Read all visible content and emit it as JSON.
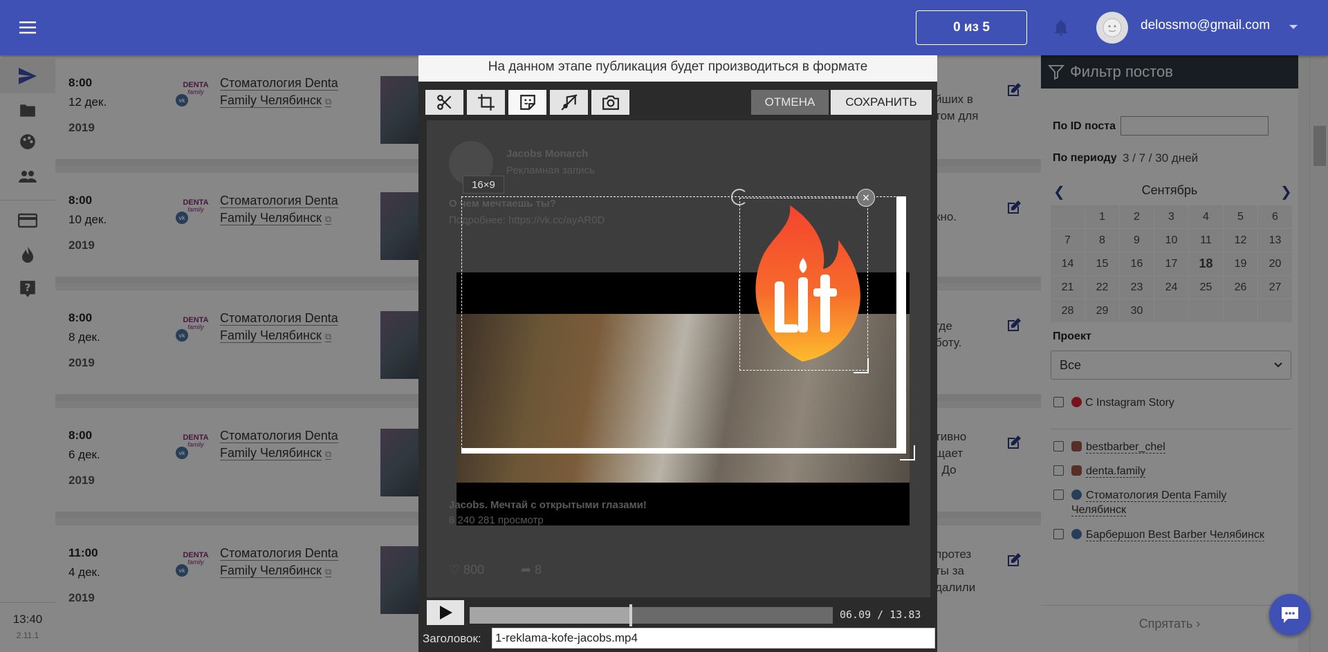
{
  "header": {
    "counter": "0 из 5",
    "user_email": "delossmo@gmail.com"
  },
  "nav": {
    "time": "13:40",
    "version": "2.11.1"
  },
  "posts": [
    {
      "time": "8:00",
      "date": "12 дек.",
      "year": "2019",
      "page": "Стоматология Denta Family Челябинск",
      "text_lines": [
        "йших в",
        "том для"
      ]
    },
    {
      "time": "8:00",
      "date": "10 дек.",
      "year": "2019",
      "page": "Стоматология Denta Family Челябинск",
      "text_lines": [
        "",
        "кно."
      ]
    },
    {
      "time": "8:00",
      "date": "8 дек.",
      "year": "2019",
      "page": "Стоматология Denta Family Челябинск",
      "text_lines": [
        "где",
        "боту."
      ]
    },
    {
      "time": "8:00",
      "date": "6 дек.",
      "year": "2019",
      "page": "Стоматология Denta Family Челябинск",
      "text_lines": [
        "тивно",
        "щает",
        ". До"
      ]
    },
    {
      "time": "11:00",
      "date": "4 дек.",
      "year": "2019",
      "page": "Стоматология Denta Family Челябинск",
      "text_lines": [
        "протез",
        "ты за",
        "далили"
      ]
    }
  ],
  "post_logo": {
    "line1": "DENTA",
    "line2": "family"
  },
  "filter": {
    "title": "Фильтр постов",
    "by_id_label": "По ID поста",
    "by_id_value": "",
    "period_label": "По периоду",
    "period_links": "3 / 7 / 30 дней",
    "month": "Сентябрь",
    "calendar": [
      "",
      "1",
      "2",
      "3",
      "4",
      "5",
      "6",
      "7",
      "8",
      "9",
      "10",
      "11",
      "12",
      "13",
      "14",
      "15",
      "16",
      "17",
      "18",
      "19",
      "20",
      "21",
      "22",
      "23",
      "24",
      "25",
      "26",
      "27",
      "28",
      "29",
      "30",
      "",
      "",
      "",
      ""
    ],
    "today": "18",
    "project_label": "Проект",
    "project_value": "Все",
    "instagram_story_label": "С Instagram Story",
    "accounts": [
      {
        "type": "instagram",
        "name": "bestbarber_chel"
      },
      {
        "type": "instagram",
        "name": "denta.family"
      },
      {
        "type": "vk",
        "name": "Стоматология Denta Family Челябинск"
      },
      {
        "type": "vk",
        "name": "Барбершоп Best Barber Челябинск"
      }
    ],
    "hide_label": "Спрятать"
  },
  "modal": {
    "top_text": "На данном этапе публикация будет производиться в формате"
  },
  "editor": {
    "tools": [
      "scissors-icon",
      "crop-icon",
      "sticker-icon",
      "mute-icon",
      "camera-icon"
    ],
    "cancel_label": "ОТМЕНА",
    "save_label": "СОХРАНИТЬ",
    "ratio": "16×9",
    "ghost_post": {
      "page_name": "Jacobs Monarch",
      "page_sub": "Рекламная запись",
      "line1": "О чем мечтаешь ты?",
      "line2": "Подробнее: https://vk.cc/ayAR0D",
      "video_title": "Jacobs. Мечтай с открытыми глазами!",
      "views": "8 240 281 просмотр",
      "likes": "800",
      "shares": "8"
    },
    "progress": 0.444,
    "timecode": "06.09 / 13.83",
    "title_label": "Заголовок:",
    "title_value": "1-reklama-kofe-jacobs.mp4"
  },
  "colors": {
    "primary": "#3f51b5",
    "filter_header": "#2f3642",
    "fire_outer": "#f4442e",
    "fire_inner": "#fdbb2d"
  }
}
